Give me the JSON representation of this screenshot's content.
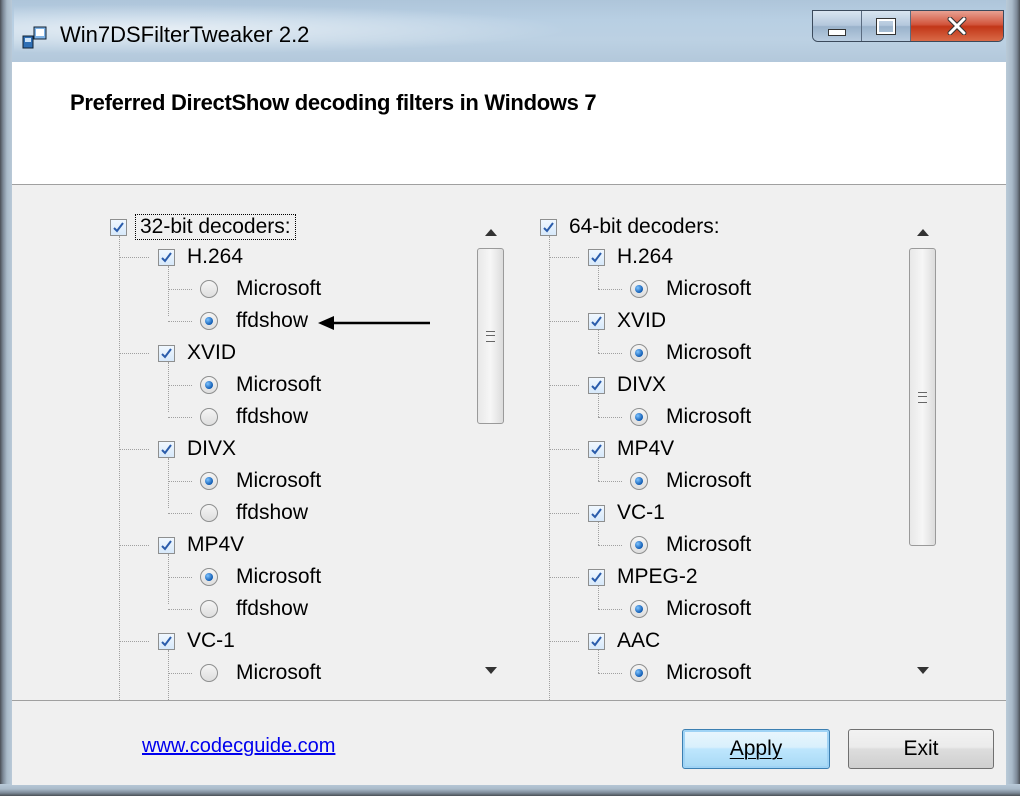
{
  "window": {
    "title": "Win7DSFilterTweaker 2.2"
  },
  "header": {
    "title": "Preferred DirectShow decoding filters in Windows 7"
  },
  "left_tree": {
    "root": {
      "label": "32-bit decoders:",
      "checked": true
    },
    "groups": [
      {
        "label": "H.264",
        "checked": true,
        "options": [
          {
            "label": "Microsoft",
            "selected": false
          },
          {
            "label": "ffdshow",
            "selected": true
          }
        ]
      },
      {
        "label": "XVID",
        "checked": true,
        "options": [
          {
            "label": "Microsoft",
            "selected": true
          },
          {
            "label": "ffdshow",
            "selected": false
          }
        ]
      },
      {
        "label": "DIVX",
        "checked": true,
        "options": [
          {
            "label": "Microsoft",
            "selected": true
          },
          {
            "label": "ffdshow",
            "selected": false
          }
        ]
      },
      {
        "label": "MP4V",
        "checked": true,
        "options": [
          {
            "label": "Microsoft",
            "selected": true
          },
          {
            "label": "ffdshow",
            "selected": false
          }
        ]
      },
      {
        "label": "VC-1",
        "checked": true,
        "options": [
          {
            "label": "Microsoft",
            "selected": false
          }
        ]
      }
    ]
  },
  "right_tree": {
    "root": {
      "label": "64-bit decoders:",
      "checked": true
    },
    "groups": [
      {
        "label": "H.264",
        "checked": true,
        "options": [
          {
            "label": "Microsoft",
            "selected": true
          }
        ]
      },
      {
        "label": "XVID",
        "checked": true,
        "options": [
          {
            "label": "Microsoft",
            "selected": true
          }
        ]
      },
      {
        "label": "DIVX",
        "checked": true,
        "options": [
          {
            "label": "Microsoft",
            "selected": true
          }
        ]
      },
      {
        "label": "MP4V",
        "checked": true,
        "options": [
          {
            "label": "Microsoft",
            "selected": true
          }
        ]
      },
      {
        "label": "VC-1",
        "checked": true,
        "options": [
          {
            "label": "Microsoft",
            "selected": true
          }
        ]
      },
      {
        "label": "MPEG-2",
        "checked": true,
        "options": [
          {
            "label": "Microsoft",
            "selected": true
          }
        ]
      },
      {
        "label": "AAC",
        "checked": true,
        "options": [
          {
            "label": "Microsoft",
            "selected": true
          }
        ]
      }
    ]
  },
  "footer": {
    "link": "www.codecguide.com",
    "apply_label": "Apply",
    "exit_label": "Exit"
  },
  "colors": {
    "link": "#0000ee",
    "accent": "#3c7fb1",
    "close_button": "#c23618"
  },
  "icons": [
    "app-icon",
    "minimize-icon",
    "maximize-icon",
    "close-icon",
    "scroll-up-icon",
    "scroll-down-icon",
    "annotation-arrow-icon"
  ]
}
